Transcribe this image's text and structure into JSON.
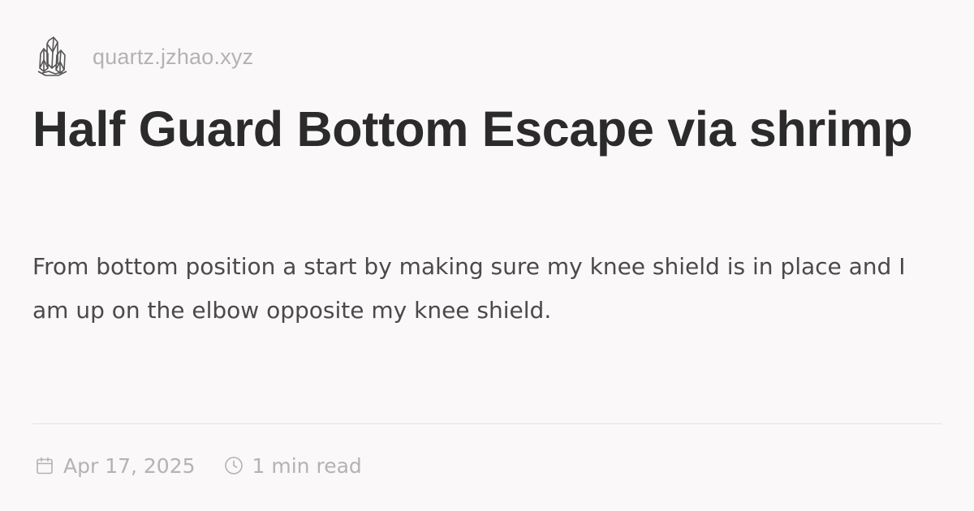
{
  "site": {
    "logo_icon": "crystal-cluster-icon",
    "url": "quartz.jzhao.xyz"
  },
  "page": {
    "title": "Half Guard Bottom Escape via shrimp",
    "description": "From bottom position a start by making sure my knee shield is in place and I am up on the elbow opposite my knee shield."
  },
  "meta": {
    "date_icon": "calendar-icon",
    "date": "Apr 17, 2025",
    "reading_time_icon": "clock-icon",
    "reading_time": "1 min read"
  },
  "colors": {
    "background": "#faf8f8",
    "title": "#2b2b2b",
    "description": "#4a4a4a",
    "muted": "#b3b3b3",
    "divider": "#e6e3e3"
  }
}
